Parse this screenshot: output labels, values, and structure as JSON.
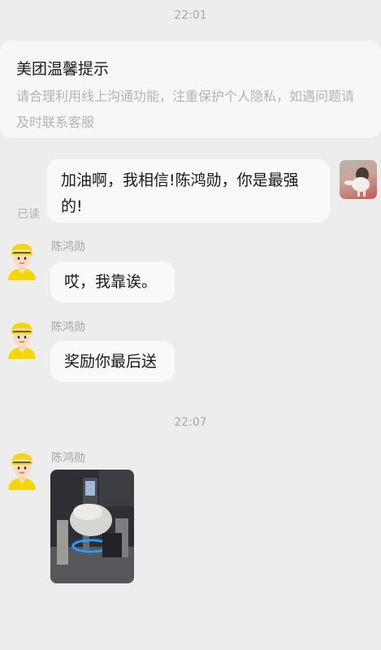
{
  "timestamps": [
    "22:01",
    "22:07"
  ],
  "notice": {
    "title": "美团温馨提示",
    "body": "请合理利用线上沟通功能，注重保护个人隐私，如遇问题请及时联系客服"
  },
  "outgoing": {
    "text": "加油啊，我相信!陈鸿勋，你是最强的!",
    "status": "已读"
  },
  "incoming": [
    {
      "sender": "陈鸿勋",
      "text": "哎，我靠诶。"
    },
    {
      "sender": "陈鸿勋",
      "text": "奖励你最后送"
    },
    {
      "sender": "陈鸿勋",
      "content": "image"
    }
  ],
  "icons": {
    "my_avatar": "user-photo-avatar",
    "courier_avatar": "yellow-helmet-rider-avatar"
  },
  "colors": {
    "background": "#ededed",
    "bubble": "#f9f9f9",
    "helmet_yellow": "#f4d600"
  }
}
